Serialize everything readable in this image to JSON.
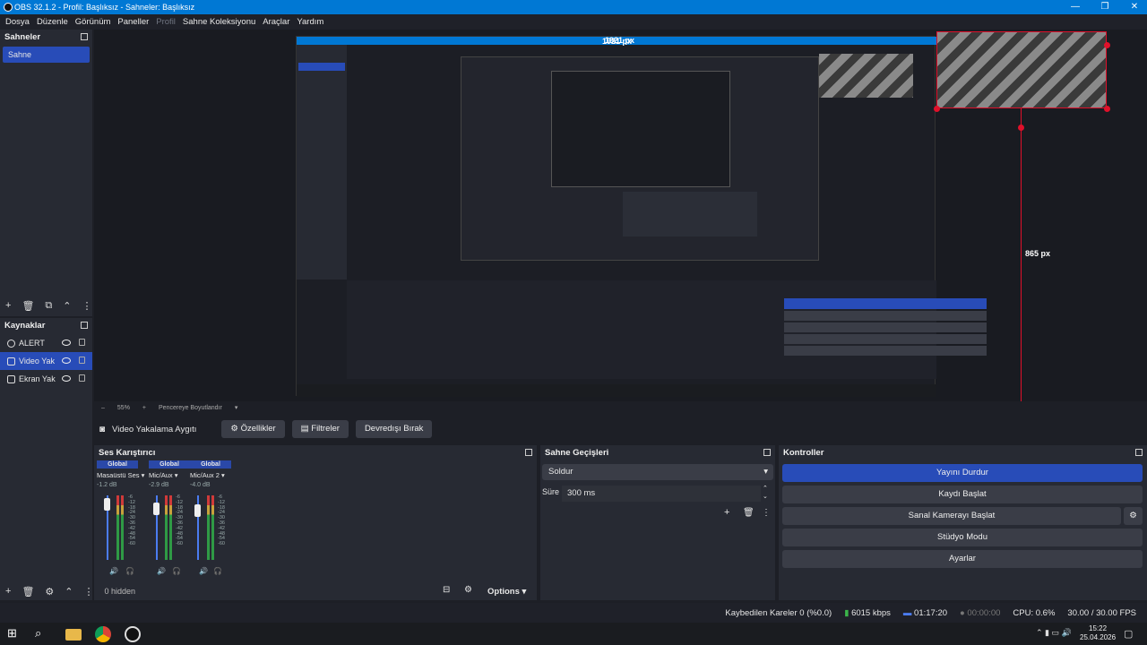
{
  "window": {
    "title": "OBS 32.1.2 - Profil: Başlıksız - Sahneler: Başlıksız",
    "minimize": "—",
    "maximize": "❐",
    "close": "✕"
  },
  "menu": [
    {
      "label": "Dosya",
      "enabled": true
    },
    {
      "label": "Düzenle",
      "enabled": true
    },
    {
      "label": "Görünüm",
      "enabled": true
    },
    {
      "label": "Paneller",
      "enabled": true
    },
    {
      "label": "Profil",
      "enabled": false
    },
    {
      "label": "Sahne Koleksiyonu",
      "enabled": true
    },
    {
      "label": "Araçlar",
      "enabled": true
    },
    {
      "label": "Yardım",
      "enabled": true
    }
  ],
  "scenes": {
    "title": "Sahneler",
    "items": [
      "Sahne"
    ]
  },
  "sources": {
    "title": "Kaynaklar",
    "items": [
      {
        "label": "ALERT",
        "icon": "globe-icon",
        "selected": false
      },
      {
        "label": "Video Yak",
        "icon": "camera-icon",
        "selected": true
      },
      {
        "label": "Ekran Yak",
        "icon": "monitor-icon",
        "selected": false
      }
    ]
  },
  "preview": {
    "label_width": "1921 px",
    "label_height": "865 px"
  },
  "zoom": {
    "value": "55%",
    "mode": "Pencereye Boyutlandır"
  },
  "source_bar": {
    "name": "Video Yakalama Aygıtı",
    "properties": "Özellikler",
    "filters": "Filtreler",
    "deactivate": "Devredışı Bırak"
  },
  "mixer": {
    "title": "Ses Karıştırıcı",
    "channels": [
      {
        "scope": "Global",
        "name": "Masaüstü Ses",
        "db": "-1.2 dB",
        "level": 0.82
      },
      {
        "scope": "Global",
        "name": "Mic/Aux",
        "db": "-2.9 dB",
        "level": 0.75
      },
      {
        "scope": "Global",
        "name": "Mic/Aux 2",
        "db": "-4.0 dB",
        "level": 0.72
      }
    ],
    "scale": [
      "-6",
      "-12",
      "-18",
      "-24",
      "-30",
      "-36",
      "-42",
      "-48",
      "-54",
      "-60"
    ],
    "hidden": "0 hidden",
    "options": "Options"
  },
  "transitions": {
    "title": "Sahne Geçişleri",
    "selected": "Soldur",
    "duration_label": "Süre",
    "duration": "300 ms"
  },
  "controls": {
    "title": "Kontroller",
    "stream": "Yayını Durdur",
    "record": "Kaydı Başlat",
    "virtual_cam": "Sanal Kamerayı Başlat",
    "studio": "Stüdyo Modu",
    "settings": "Ayarlar"
  },
  "status": {
    "dropped": "Kaybedilen Kareler 0 (%0.0)",
    "bitrate": "6015 kbps",
    "stream_time": "01:17:20",
    "rec_time": "00:00:00",
    "cpu": "CPU: 0.6%",
    "fps": "30.00 / 30.00 FPS"
  },
  "taskbar": {
    "time": "15:22",
    "date": "25.04.2026"
  },
  "colors": {
    "accent": "#284cb8",
    "titlebar": "#0078d4",
    "red_guide": "#e0102a"
  }
}
